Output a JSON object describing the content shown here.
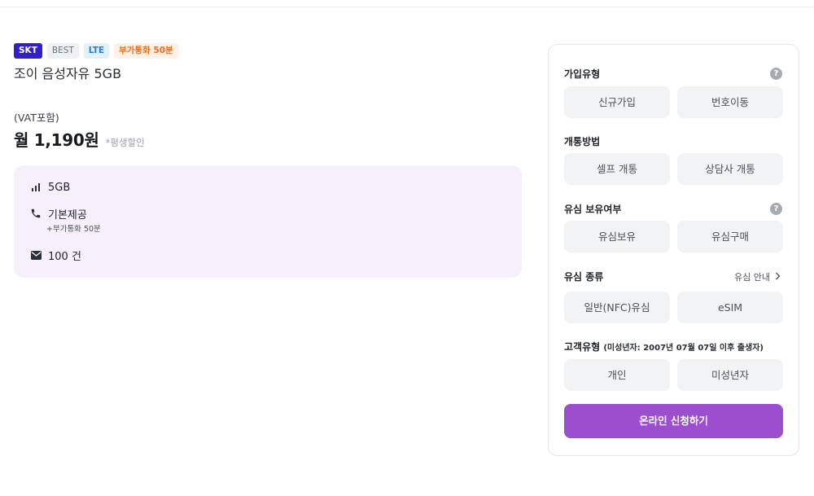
{
  "plan": {
    "tags": [
      {
        "label": "SKT",
        "kind": "carrier",
        "color": "#2f1fcf"
      },
      {
        "label": "BEST",
        "kind": "best"
      },
      {
        "label": "LTE",
        "kind": "network",
        "color": "#2b7bd6"
      },
      {
        "label": "부가통화 50분",
        "kind": "extra",
        "color": "#ef6b17"
      }
    ],
    "name": "조이 음성자유 5GB",
    "vat_label": "(VAT포함)",
    "price": "월 1,190원",
    "price_note": "*평생할인",
    "features": {
      "data": {
        "icon": "signal-bars-icon",
        "label": "5GB"
      },
      "voice": {
        "icon": "phone-icon",
        "label": "기본제공",
        "sub": "+부가통화 50분"
      },
      "sms": {
        "icon": "envelope-icon",
        "label": "100 건"
      }
    }
  },
  "form": {
    "join_type": {
      "title": "가입유형",
      "help": "?",
      "options": [
        "신규가입",
        "번호이동"
      ]
    },
    "activation": {
      "title": "개통방법",
      "options": [
        "셀프 개통",
        "상담사 개통"
      ]
    },
    "usim_owned": {
      "title": "유심 보유여부",
      "help": "?",
      "options": [
        "유심보유",
        "유심구매"
      ]
    },
    "usim_type": {
      "title": "유심 종류",
      "guide": "유심 안내",
      "options": [
        "일반(NFC)유심",
        "eSIM"
      ]
    },
    "customer_type": {
      "title": "고객유형",
      "note": "(미성년자: 2007년 07월 07일 이후 출생자)",
      "options": [
        "개인",
        "미성년자"
      ]
    },
    "apply_label": "온라인 신청하기",
    "accent_color": "#9b4fcf"
  }
}
